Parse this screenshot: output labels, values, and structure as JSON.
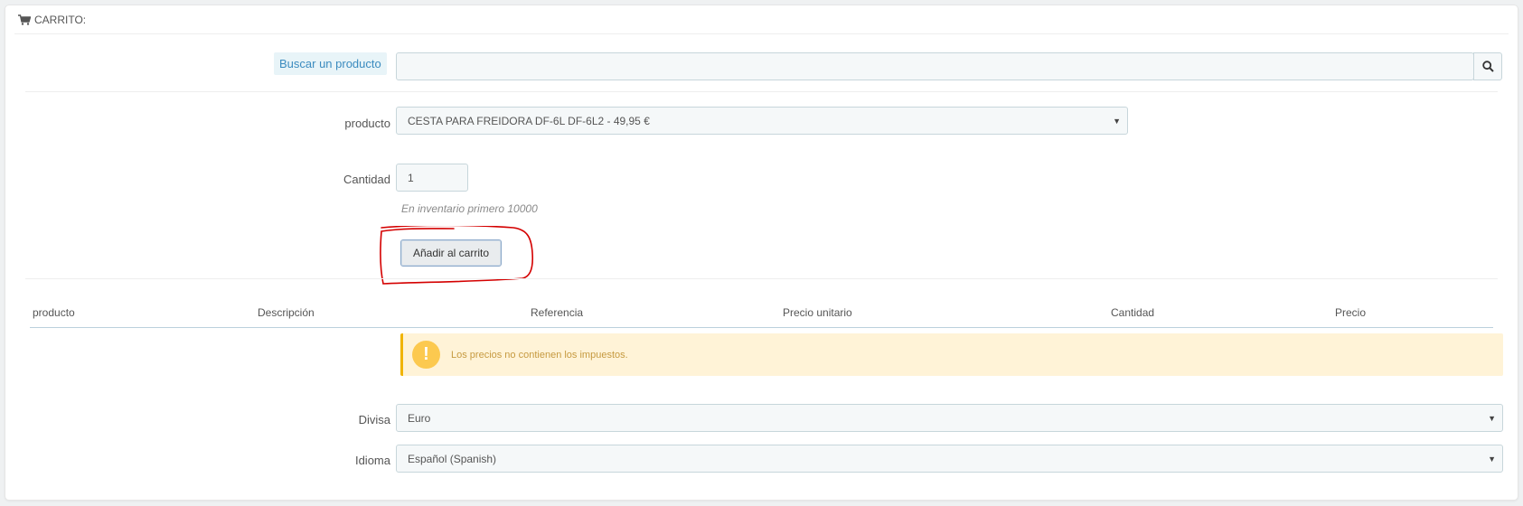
{
  "panel": {
    "title": "CARRITO:"
  },
  "search": {
    "label": "Buscar un producto",
    "value": "",
    "icon": "search-icon"
  },
  "product": {
    "label": "producto",
    "selected": "CESTA PARA FREIDORA DF-6L DF-6L2 - 49,95 €"
  },
  "quantity": {
    "label": "Cantidad",
    "value": "1",
    "help": "En inventario primero 10000"
  },
  "add_button": {
    "label": "Añadir al carrito"
  },
  "table": {
    "columns": [
      "producto",
      "Descripción",
      "Referencia",
      "Precio unitario",
      "Cantidad",
      "Precio"
    ]
  },
  "alert": {
    "text": "Los precios no contienen los impuestos.",
    "icon": "exclamation-icon",
    "color": "#fcc94f"
  },
  "currency": {
    "label": "Divisa",
    "selected": "Euro"
  },
  "language": {
    "label": "Idioma",
    "selected": "Español (Spanish)"
  },
  "colors": {
    "accent": "#3b8bbf",
    "warning_bg": "#fff3d7",
    "annotation": "#d40000"
  }
}
